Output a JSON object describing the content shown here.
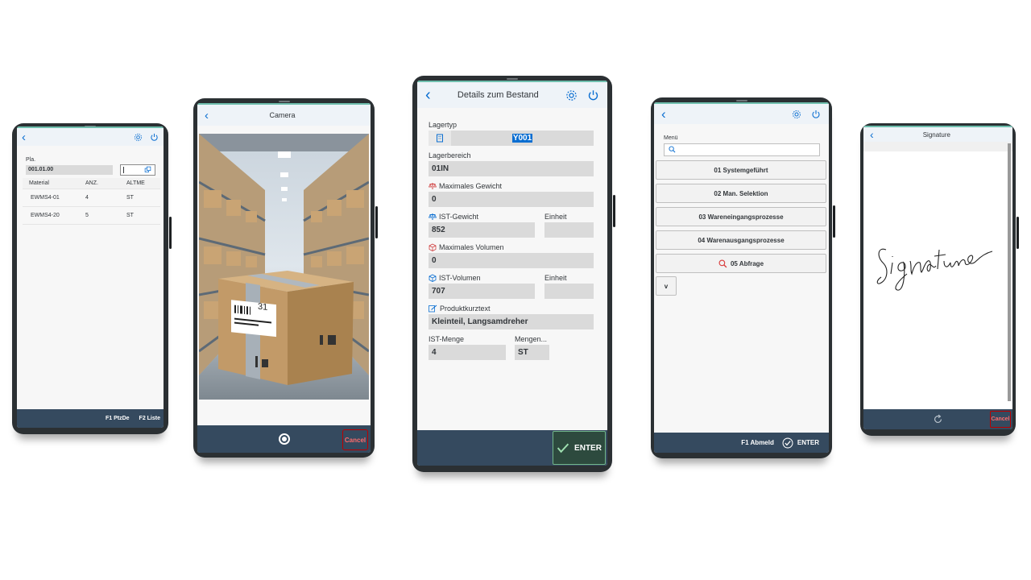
{
  "phone1": {
    "field_label": "Pla.",
    "field_value": "001.01.00",
    "columns": [
      "Material",
      "ANZ.",
      "ALTME"
    ],
    "rows": [
      [
        "EWMS4-01",
        "4",
        "ST"
      ],
      [
        "EWMS4-20",
        "5",
        "ST"
      ]
    ],
    "footer": [
      "F1 PtzDe",
      "F2 Liste"
    ]
  },
  "phone2": {
    "title": "Camera",
    "cancel_label": "Cancel",
    "photo_label_text": "31"
  },
  "phone3": {
    "title": "Details zum Bestand",
    "lagertyp_label": "Lagertyp",
    "lagertyp_value": "Y001",
    "lagerbereich_label": "Lagerbereich",
    "lagerbereich_value": "01IN",
    "max_gewicht_label": "Maximales Gewicht",
    "max_gewicht_value": "0",
    "ist_gewicht_label": "IST-Gewicht",
    "ist_gewicht_value": "852",
    "einheit1_label": "Einheit",
    "einheit1_value": "",
    "max_volumen_label": "Maximales Volumen",
    "max_volumen_value": "0",
    "ist_volumen_label": "IST-Volumen",
    "ist_volumen_value": "707",
    "einheit2_label": "Einheit",
    "einheit2_value": "",
    "produkt_label": "Produktkurztext",
    "produkt_value": "Kleinteil, Langsamdreher",
    "ist_menge_label": "IST-Menge",
    "ist_menge_value": "4",
    "mengen_label": "Mengen...",
    "mengen_value": "ST",
    "enter_label": "ENTER"
  },
  "phone4": {
    "menu_label": "Menü",
    "search_value": "",
    "items": [
      "01 Systemgeführt",
      "02 Man. Selektion",
      "03 Wareneingangsprozesse",
      "04 Warenausgangsprozesse",
      "05 Abfrage"
    ],
    "more_label": "v",
    "footer_f1": "F1 Abmeld",
    "footer_enter": "ENTER"
  },
  "phone5": {
    "title": "Signature",
    "cancel_label": "Cancel"
  },
  "colors": {
    "accent": "#0a6ed1",
    "footer": "#354a5f",
    "header": "#eef3f8",
    "field": "#dadada",
    "cancel": "#bb0000"
  }
}
